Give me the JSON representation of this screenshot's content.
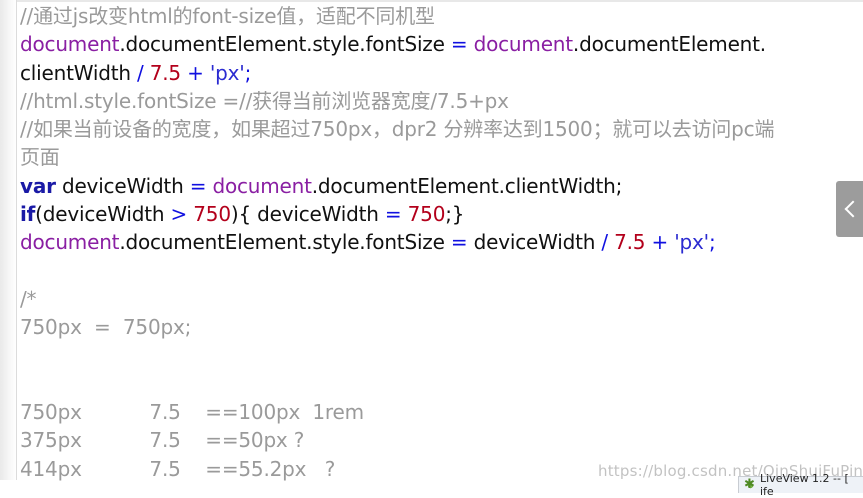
{
  "code_lines": [
    [
      {
        "t": "//通过js改变html的font-size值，适配不同机型",
        "c": "cm"
      }
    ],
    [
      {
        "t": "document",
        "c": "obj"
      },
      {
        "t": ".documentElement.style.fontSize ",
        "c": "id"
      },
      {
        "t": "=",
        "c": "op"
      },
      {
        "t": " ",
        "c": "id"
      },
      {
        "t": "document",
        "c": "obj"
      },
      {
        "t": ".documentElement.",
        "c": "id"
      }
    ],
    [
      {
        "t": "clientWidth ",
        "c": "id"
      },
      {
        "t": "/",
        "c": "op"
      },
      {
        "t": " ",
        "c": "id"
      },
      {
        "t": "7.5",
        "c": "num"
      },
      {
        "t": " ",
        "c": "id"
      },
      {
        "t": "+",
        "c": "op"
      },
      {
        "t": " ",
        "c": "id"
      },
      {
        "t": "'px'",
        "c": "str"
      },
      {
        "t": ";",
        "c": "punc"
      }
    ],
    [
      {
        "t": "//html.style.fontSize =//获得当前浏览器宽度/7.5+px",
        "c": "cm"
      }
    ],
    [
      {
        "t": "//如果当前设备的宽度，如果超过750px，dpr2 分辨率达到1500；就可以去访问pc端",
        "c": "cm"
      }
    ],
    [
      {
        "t": "页面",
        "c": "cm"
      }
    ],
    [
      {
        "t": "var",
        "c": "kw"
      },
      {
        "t": " deviceWidth ",
        "c": "id"
      },
      {
        "t": "=",
        "c": "op"
      },
      {
        "t": " ",
        "c": "id"
      },
      {
        "t": "document",
        "c": "obj"
      },
      {
        "t": ".documentElement.clientWidth;",
        "c": "id"
      }
    ],
    [
      {
        "t": "if",
        "c": "kw"
      },
      {
        "t": "(deviceWidth ",
        "c": "id"
      },
      {
        "t": ">",
        "c": "op"
      },
      {
        "t": " ",
        "c": "id"
      },
      {
        "t": "750",
        "c": "num"
      },
      {
        "t": "){",
        "c": "id"
      },
      {
        "t": " deviceWidth ",
        "c": "id"
      },
      {
        "t": "=",
        "c": "op"
      },
      {
        "t": " ",
        "c": "id"
      },
      {
        "t": "750",
        "c": "num"
      },
      {
        "t": ";}",
        "c": "id"
      }
    ],
    [
      {
        "t": "document",
        "c": "obj"
      },
      {
        "t": ".documentElement.style.fontSize ",
        "c": "id"
      },
      {
        "t": "=",
        "c": "op"
      },
      {
        "t": " deviceWidth ",
        "c": "id"
      },
      {
        "t": "/",
        "c": "op"
      },
      {
        "t": " ",
        "c": "id"
      },
      {
        "t": "7.5",
        "c": "num"
      },
      {
        "t": " ",
        "c": "id"
      },
      {
        "t": "+",
        "c": "op"
      },
      {
        "t": " ",
        "c": "id"
      },
      {
        "t": "'px'",
        "c": "str"
      },
      {
        "t": ";",
        "c": "punc"
      }
    ],
    [],
    [
      {
        "t": "/*",
        "c": "cm"
      }
    ],
    [
      {
        "t": "750px  =  750px;",
        "c": "cm"
      }
    ],
    [],
    [],
    [
      {
        "t": "750px           7.5    ==100px  1rem",
        "c": "cm"
      }
    ],
    [
      {
        "t": "375px           7.5    ==50px ?",
        "c": "cm"
      }
    ],
    [
      {
        "t": "414px           7.5    ==55.2px   ?",
        "c": "cm"
      }
    ]
  ],
  "watermark": "https://blog.csdn.net/QinShuiFuPing",
  "statusbar": {
    "label": "LiveView 1.2 -- [ ife"
  }
}
